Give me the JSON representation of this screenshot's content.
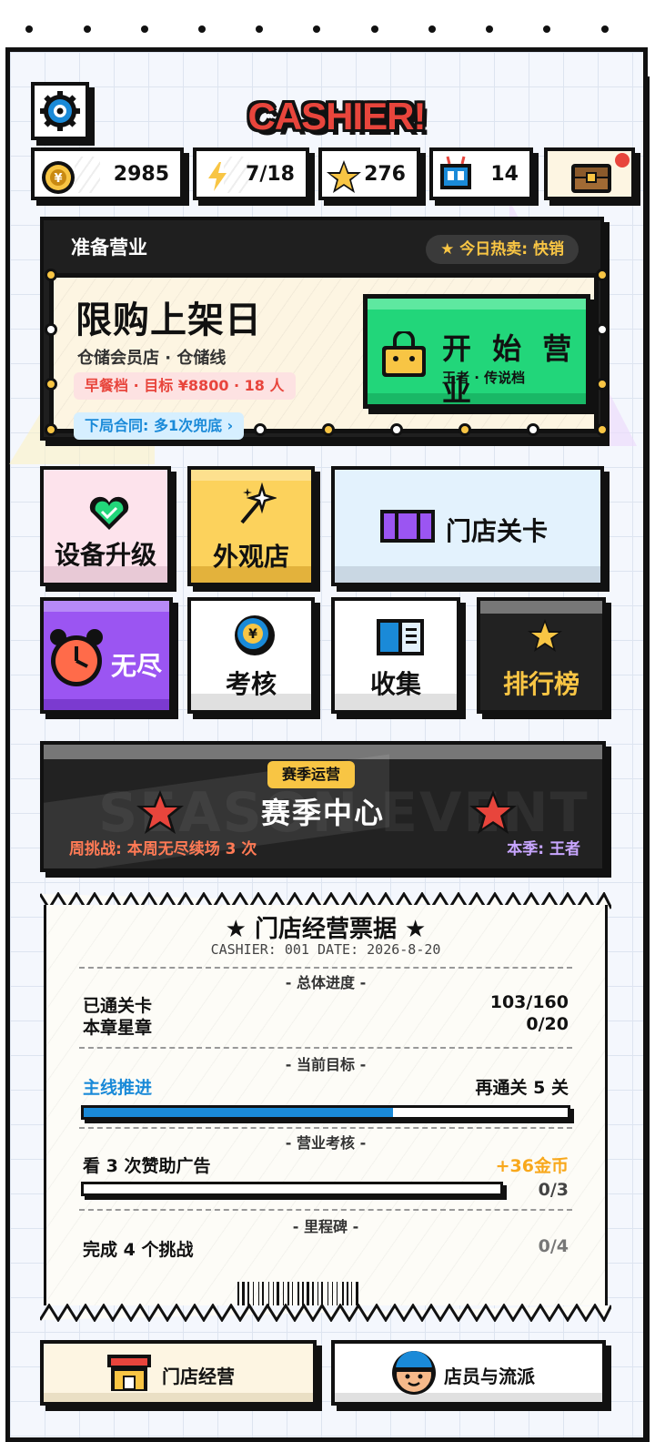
{
  "header": {
    "title": "CASHIER!"
  },
  "stats": [
    {
      "icon": "coin-icon",
      "value": "2985"
    },
    {
      "icon": "lightning-icon",
      "value": "7/18"
    },
    {
      "icon": "star-icon",
      "value": "276"
    },
    {
      "icon": "robot-icon",
      "value": "14"
    },
    {
      "icon": "chest-icon",
      "value": ""
    }
  ],
  "ready": {
    "label": "准备营业",
    "hot": "★ 今日热卖: 快销",
    "headline": "限购上架日",
    "store": "仓储会员店 · 仓储线",
    "goal": "早餐档 · 目标 ¥8800 · 18 人",
    "contract": "下局合同: 多1次兜底 ›",
    "start_label": "开 始 营 业",
    "start_sub": "王者 · 传说档"
  },
  "tiles": {
    "upgrade": "设备升级",
    "shop": "外观店",
    "levels": "门店关卡",
    "endless": "无尽",
    "exam": "考核",
    "collect": "收集",
    "rank": "排行榜"
  },
  "season": {
    "tag": "赛季运营",
    "title": "赛季中心",
    "bg_word": "SEASON EVENT",
    "weekly": "周挑战: 本周无尽续场 3 次",
    "current": "本季: 王者"
  },
  "receipt": {
    "title": "★ 门店经营票据 ★",
    "meta": "CASHIER: 001    DATE: 2026-8-20",
    "sec1": "- 总体进度 -",
    "cleared_label": "已通关卡",
    "cleared_value": "103/160",
    "stars_label": "本章星章",
    "stars_value": "0/20",
    "sec2": "- 当前目标 -",
    "goal_label": "主线推进",
    "goal_value": "再通关 5 关",
    "goal_progress": 0.64,
    "sec3": "- 营业考核 -",
    "task_label": "看 3 次赞助广告",
    "task_reward": "+36金币",
    "task_value": "0/3",
    "task_progress": 0,
    "sec4": "- 里程碑 -",
    "mile_label": "完成 4 个挑战",
    "mile_value": "0/4"
  },
  "nav": {
    "store": "门店经营",
    "staff": "店员与流派"
  },
  "colors": {
    "accent_red": "#e8453c",
    "accent_green": "#22d67a",
    "accent_yellow": "#f8c544",
    "accent_blue": "#1a8ad8",
    "accent_purple": "#9b55f2"
  }
}
